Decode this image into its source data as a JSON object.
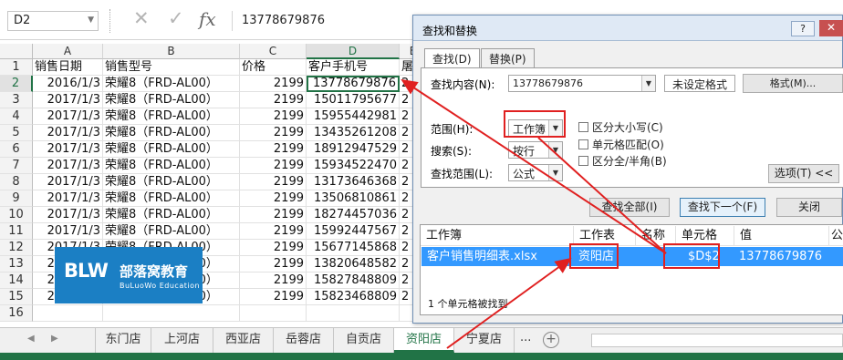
{
  "formula_bar": {
    "name_box": "D2",
    "fx_label": "fx",
    "value": "13778679876"
  },
  "grid": {
    "columns": [
      "A",
      "B",
      "C",
      "D",
      "E"
    ],
    "rows": [
      {
        "n": "1",
        "a": "销售日期",
        "b": "销售型号",
        "c": "价格",
        "d": "客户手机号",
        "e": "屠"
      },
      {
        "n": "2",
        "a": "2016/1/3",
        "b": "荣耀8（FRD-AL00）",
        "c": "2199",
        "d": "13778679876",
        "e": "2"
      },
      {
        "n": "3",
        "a": "2017/1/3",
        "b": "荣耀8（FRD-AL00）",
        "c": "2199",
        "d": "15011795677",
        "e": "2"
      },
      {
        "n": "4",
        "a": "2017/1/3",
        "b": "荣耀8（FRD-AL00）",
        "c": "2199",
        "d": "15955442981",
        "e": "2"
      },
      {
        "n": "5",
        "a": "2017/1/3",
        "b": "荣耀8（FRD-AL00）",
        "c": "2199",
        "d": "13435261208",
        "e": "2"
      },
      {
        "n": "6",
        "a": "2017/1/3",
        "b": "荣耀8（FRD-AL00）",
        "c": "2199",
        "d": "18912947529",
        "e": "2"
      },
      {
        "n": "7",
        "a": "2017/1/3",
        "b": "荣耀8（FRD-AL00）",
        "c": "2199",
        "d": "15934522470",
        "e": "2"
      },
      {
        "n": "8",
        "a": "2017/1/3",
        "b": "荣耀8（FRD-AL00）",
        "c": "2199",
        "d": "13173646368",
        "e": "2"
      },
      {
        "n": "9",
        "a": "2017/1/3",
        "b": "荣耀8（FRD-AL00）",
        "c": "2199",
        "d": "13506810861",
        "e": "2"
      },
      {
        "n": "10",
        "a": "2017/1/3",
        "b": "荣耀8（FRD-AL00）",
        "c": "2199",
        "d": "18274457036",
        "e": "2"
      },
      {
        "n": "11",
        "a": "2017/1/3",
        "b": "荣耀8（FRD-AL00）",
        "c": "2199",
        "d": "15992447567",
        "e": "2"
      },
      {
        "n": "12",
        "a": "2017/1/3",
        "b": "荣耀8（FRD-AL00）",
        "c": "2199",
        "d": "15677145868",
        "e": "2"
      },
      {
        "n": "13",
        "a": "2017/1/3",
        "b": "荣耀8（FRD-AL00）",
        "c": "2199",
        "d": "13820648582",
        "e": "2"
      },
      {
        "n": "14",
        "a": "2017/1/3",
        "b": "荣耀8（FRD-AL00）",
        "c": "2199",
        "d": "15827848809",
        "e": "2"
      },
      {
        "n": "15",
        "a": "2017/1/3",
        "b": "荣耀8（FRD-AL00）",
        "c": "2199",
        "d": "15823468809",
        "e": "2"
      },
      {
        "n": "16",
        "a": "",
        "b": "",
        "c": "",
        "d": "",
        "e": ""
      }
    ]
  },
  "logo": {
    "mark": "BLW",
    "name": "部落窝教育",
    "english": "BuLuoWo Education"
  },
  "sheet_tabs": {
    "tabs": [
      "东门店",
      "上河店",
      "西亚店",
      "岳蓉店",
      "自贡店",
      "资阳店",
      "宁夏店"
    ],
    "active": "资阳店",
    "more": "...",
    "add": "+"
  },
  "dialog": {
    "title": "查找和替换",
    "help": "?",
    "close": "✕",
    "tab_find": "查找(D)",
    "tab_replace": "替换(P)",
    "find_what_label": "查找内容(N):",
    "find_what_value": "13778679876",
    "format_status": "未设定格式",
    "format_button": "格式(M)...",
    "within_label": "范围(H):",
    "within_value": "工作簿",
    "search_label": "搜索(S):",
    "search_value": "按行",
    "look_in_label": "查找范围(L):",
    "look_in_value": "公式",
    "match_case": "区分大小写(C)",
    "match_cell": "单元格匹配(O)",
    "match_width": "区分全/半角(B)",
    "options_button": "选项(T) <<",
    "find_all_button": "查找全部(I)",
    "find_next_button": "查找下一个(F)",
    "close_button": "关闭",
    "results": {
      "headers": [
        "工作簿",
        "工作表",
        "名称",
        "单元格",
        "值",
        "公"
      ],
      "row": {
        "workbook": "客户销售明细表.xlsx",
        "sheet": "资阳店",
        "name": "",
        "cell": "$D$2",
        "value": "13778679876"
      },
      "count": "1 个单元格被找到"
    }
  },
  "colors": {
    "excel_green": "#217346",
    "selection_blue": "#3399ff",
    "annotation_red": "#e02020",
    "logo_blue": "#1b7fc4"
  }
}
